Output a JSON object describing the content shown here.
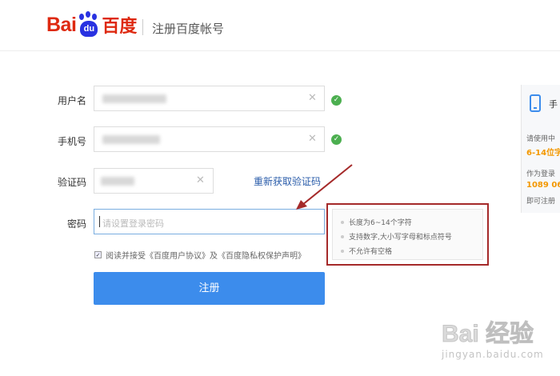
{
  "header": {
    "logo_bai": "Bai",
    "logo_du": "du",
    "logo_cn": "百度",
    "title": "注册百度帐号"
  },
  "form": {
    "username_label": "用户名",
    "phone_label": "手机号",
    "code_label": "验证码",
    "resend_code": "重新获取验证码",
    "password_label": "密码",
    "password_placeholder": "请设置登录密码",
    "agree_text": "阅读并接受《百度用户协议》及《百度隐私权保护声明》",
    "register_button": "注册"
  },
  "password_tips": [
    "长度为6~14个字符",
    "支持数字,大小写字母和标点符号",
    "不允许有空格"
  ],
  "side_panel": {
    "title": "手",
    "line1": "请使用中",
    "highlight1": "6-14位字",
    "line2": "作为登录",
    "highlight2": "1089 06",
    "line3": "即可注册"
  },
  "watermark": {
    "main": "Bai 经验",
    "sub": "jingyan.baidu.com"
  },
  "colors": {
    "brand_red": "#de2910",
    "brand_blue": "#2932e1",
    "button_blue": "#3c8cec",
    "success_green": "#4caf50",
    "annotation_red": "#a52a2a"
  },
  "icons": [
    "check-icon",
    "clear-icon",
    "phone-icon",
    "arrow-annotation"
  ]
}
